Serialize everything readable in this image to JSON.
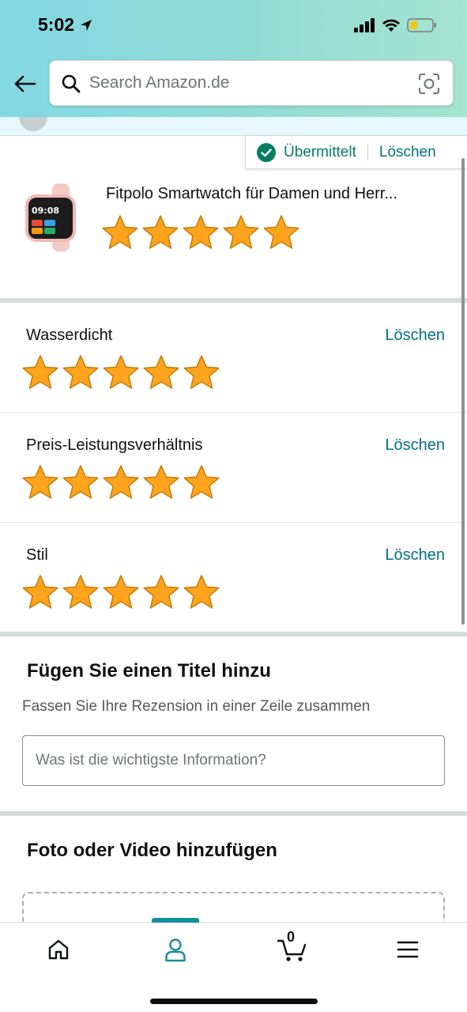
{
  "status_bar": {
    "time": "5:02"
  },
  "search": {
    "placeholder": "Search Amazon.de"
  },
  "submission": {
    "status": "Übermittelt",
    "delete": "Löschen"
  },
  "product": {
    "title": "Fitpolo Smartwatch für Damen und Herr...",
    "thumb_time": "09:08",
    "rating": 5,
    "max_rating": 5
  },
  "attributes": [
    {
      "label": "Wasserdicht",
      "delete": "Löschen",
      "rating": 5
    },
    {
      "label": "Preis-Leistungsverhältnis",
      "delete": "Löschen",
      "rating": 5
    },
    {
      "label": "Stil",
      "delete": "Löschen",
      "rating": 5
    }
  ],
  "title_section": {
    "heading": "Fügen Sie einen Titel hinzu",
    "subheading": "Fassen Sie Ihre Rezension in einer Zeile zusammen",
    "placeholder": "Was ist die wichtigste Information?"
  },
  "media_section": {
    "heading": "Foto oder Video hinzufügen"
  },
  "bottom_nav": {
    "items": [
      {
        "icon": "home-icon",
        "active": false
      },
      {
        "icon": "account-icon",
        "active": true
      },
      {
        "icon": "cart-icon",
        "active": false
      },
      {
        "icon": "menu-icon",
        "active": false
      }
    ],
    "cart_count": "0"
  },
  "colors": {
    "link": "#007185",
    "success": "#067d62",
    "star_fill": "#ffa41c",
    "active_tab": "#168f9c",
    "header_gradient_start": "#82d8e3",
    "header_gradient_end": "#a5e4cf"
  }
}
